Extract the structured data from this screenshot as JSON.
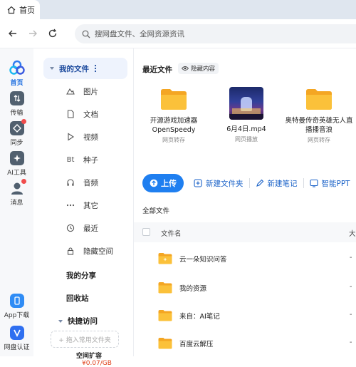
{
  "tab": {
    "title": "首页"
  },
  "search": {
    "placeholder": "搜网盘文件、全网资源资讯"
  },
  "rail": [
    {
      "label": "首页",
      "icon": "home-icon"
    },
    {
      "label": "传输",
      "icon": "transfer-icon"
    },
    {
      "label": "同步",
      "icon": "sync-icon"
    },
    {
      "label": "AI工具",
      "icon": "ai-tools-icon"
    },
    {
      "label": "消息",
      "icon": "message-icon"
    },
    {
      "label": "App下载",
      "icon": "app-download-icon"
    },
    {
      "label": "网盘认证",
      "icon": "verify-icon"
    }
  ],
  "sidebar": {
    "my_files": "我的文件",
    "items": [
      {
        "label": "图片",
        "icon": "picture-icon"
      },
      {
        "label": "文档",
        "icon": "document-icon"
      },
      {
        "label": "视频",
        "icon": "video-icon"
      },
      {
        "label": "种子",
        "icon": "bt-icon",
        "glyph": "Bt"
      },
      {
        "label": "音频",
        "icon": "audio-icon"
      },
      {
        "label": "其它",
        "icon": "more-icon"
      },
      {
        "label": "最近",
        "icon": "recent-icon"
      },
      {
        "label": "隐藏空间",
        "icon": "lock-icon"
      }
    ],
    "my_share": "我的分享",
    "recycle": "回收站",
    "quick_access": "快捷访问",
    "add_fav": "+ 拖入常用文件夹",
    "promo_title": "空间扩容",
    "promo_price": "¥0.07/GB"
  },
  "recent": {
    "title": "最近文件",
    "hide_label": "隐藏内容",
    "items": [
      {
        "name": "开源游戏加速器OpenSpeedy",
        "sub": "网页转存",
        "kind": "folder"
      },
      {
        "name": "6月4日.mp4",
        "sub": "网页播放",
        "kind": "video"
      },
      {
        "name": "奥特曼传奇英雄无人直播播音浪",
        "sub": "网页转存",
        "kind": "folder"
      }
    ]
  },
  "toolbar": {
    "upload": "上传",
    "new_folder": "新建文件夹",
    "new_note": "新建笔记",
    "smart_ppt": "智能PPT"
  },
  "files": {
    "section_title": "全部文件",
    "col_name": "文件名",
    "col_size": "大",
    "rows": [
      {
        "name": "云一朵知识问答",
        "size": "-"
      },
      {
        "name": "我的资源",
        "size": "-"
      },
      {
        "name": "来自：AI笔记",
        "size": "-"
      },
      {
        "name": "百度云解压",
        "size": "-"
      }
    ]
  },
  "colors": {
    "accent": "#1f7ff0",
    "folder": "#f7b52c",
    "rail_bg": "#f7f8fa"
  }
}
